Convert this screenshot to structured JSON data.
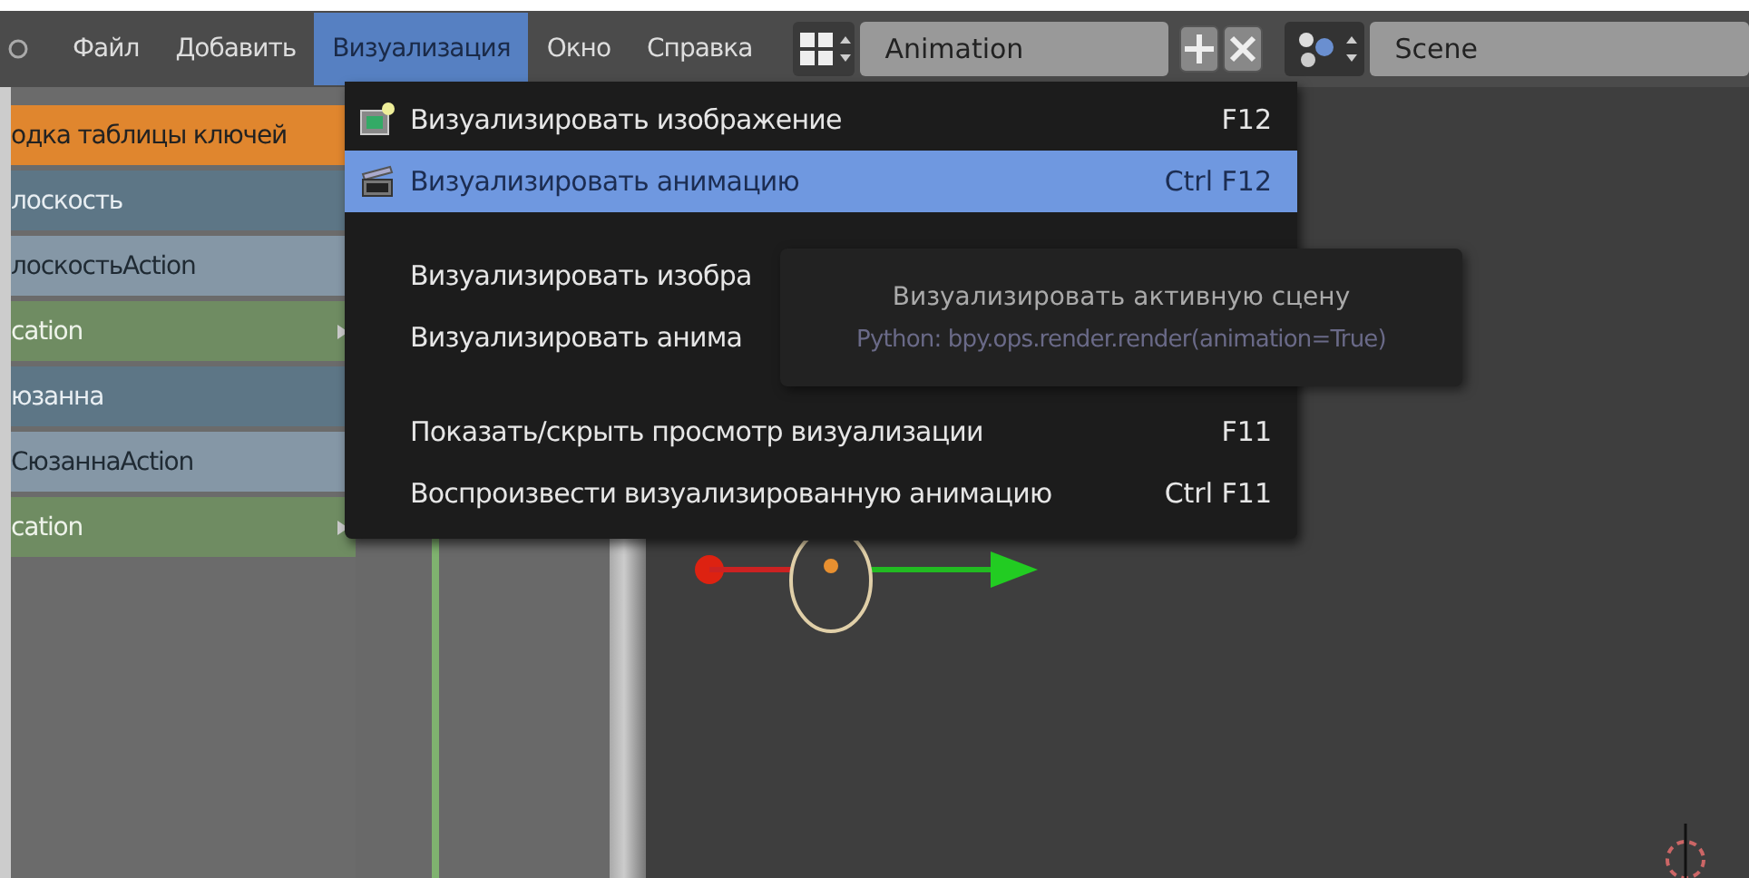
{
  "menubar": {
    "menus": [
      {
        "label": "Файл",
        "selected": false
      },
      {
        "label": "Добавить",
        "selected": false
      },
      {
        "label": "Визуализация",
        "selected": true
      },
      {
        "label": "Окно",
        "selected": false
      },
      {
        "label": "Справка",
        "selected": false
      }
    ],
    "layout_field": "Animation",
    "scene_field": "Scene"
  },
  "channels": [
    {
      "label": "одка таблицы ключей",
      "kind": "summary",
      "expander": false
    },
    {
      "label": "лоскость",
      "kind": "object",
      "expander": false
    },
    {
      "label": "лоскостьAction",
      "kind": "action",
      "expander": false
    },
    {
      "label": "cation",
      "kind": "group",
      "expander": true
    },
    {
      "label": "юзанна",
      "kind": "object",
      "expander": false
    },
    {
      "label": "СюзаннаAction",
      "kind": "action",
      "expander": false
    },
    {
      "label": "cation",
      "kind": "group",
      "expander": true
    }
  ],
  "render_menu": {
    "items": [
      {
        "kind": "item",
        "label": "Визуализировать изображение",
        "shortcut": "F12",
        "selected": false
      },
      {
        "kind": "item",
        "label": "Визуализировать анимацию",
        "shortcut": "Ctrl F12",
        "selected": true
      },
      {
        "kind": "separator"
      },
      {
        "kind": "item",
        "label": "Визуализировать изобра",
        "selected": false
      },
      {
        "kind": "item",
        "label": "Визуализировать анима",
        "selected": false
      },
      {
        "kind": "separator"
      },
      {
        "kind": "item",
        "label": "Показать/скрыть просмотр визуализации",
        "shortcut": "F11",
        "selected": false
      },
      {
        "kind": "item",
        "label": "Воспроизвести визуализированную анимацию",
        "shortcut": "Ctrl F11",
        "selected": false
      }
    ]
  },
  "tooltip": {
    "title": "Визуализировать активную сцену",
    "python": "Python: bpy.ops.render.render(animation=True)"
  }
}
